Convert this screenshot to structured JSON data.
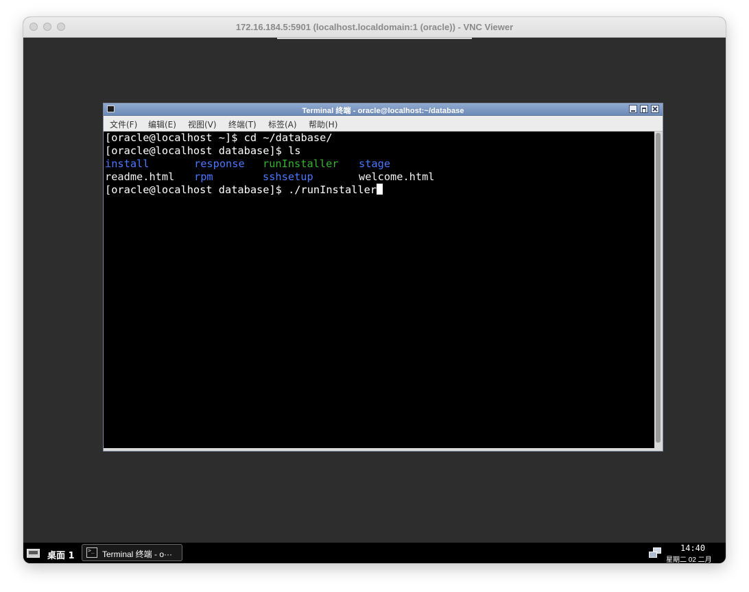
{
  "vnc_window": {
    "title": "172.16.184.5:5901 (localhost.localdomain:1 (oracle)) - VNC Viewer"
  },
  "terminal": {
    "title": "Terminal 终端 - oracle@localhost:~/database",
    "menu": [
      "文件(F)",
      "编辑(E)",
      "视图(V)",
      "终端(T)",
      "标签(A)",
      "帮助(H)"
    ],
    "lines": [
      {
        "text": "[oracle@localhost ~]$ cd ~/database/"
      },
      {
        "text": "[oracle@localhost database]$ ls"
      },
      {
        "items": [
          {
            "text": "install",
            "color": "blue"
          },
          {
            "text": "response",
            "color": "blue"
          },
          {
            "text": "runInstaller",
            "color": "green"
          },
          {
            "text": "stage",
            "color": "blue"
          }
        ]
      },
      {
        "items": [
          {
            "text": "readme.html",
            "color": "white"
          },
          {
            "text": "rpm",
            "color": "blue"
          },
          {
            "text": "sshsetup",
            "color": "blue"
          },
          {
            "text": "welcome.html",
            "color": "white"
          }
        ]
      },
      {
        "text": "[oracle@localhost database]$ ./runInstaller",
        "cursor": true
      }
    ]
  },
  "taskbar": {
    "workspace_label": "桌面 1",
    "task_label": "Terminal 终端 - o···",
    "clock_time": "14:40",
    "clock_date": "星期二 02 二月"
  },
  "colors": {
    "blue": "#4a78ff",
    "green": "#33b52d",
    "white": "#f2f2f2",
    "desktop_bg": "#2d2d2d",
    "terminal_bg": "#000000"
  },
  "icons": [
    "close-dot-icon",
    "minimize-dot-icon",
    "zoom-dot-icon",
    "terminal-icon",
    "minimize-icon",
    "maximize-icon",
    "close-icon",
    "workspace-icon",
    "network-icon"
  ]
}
